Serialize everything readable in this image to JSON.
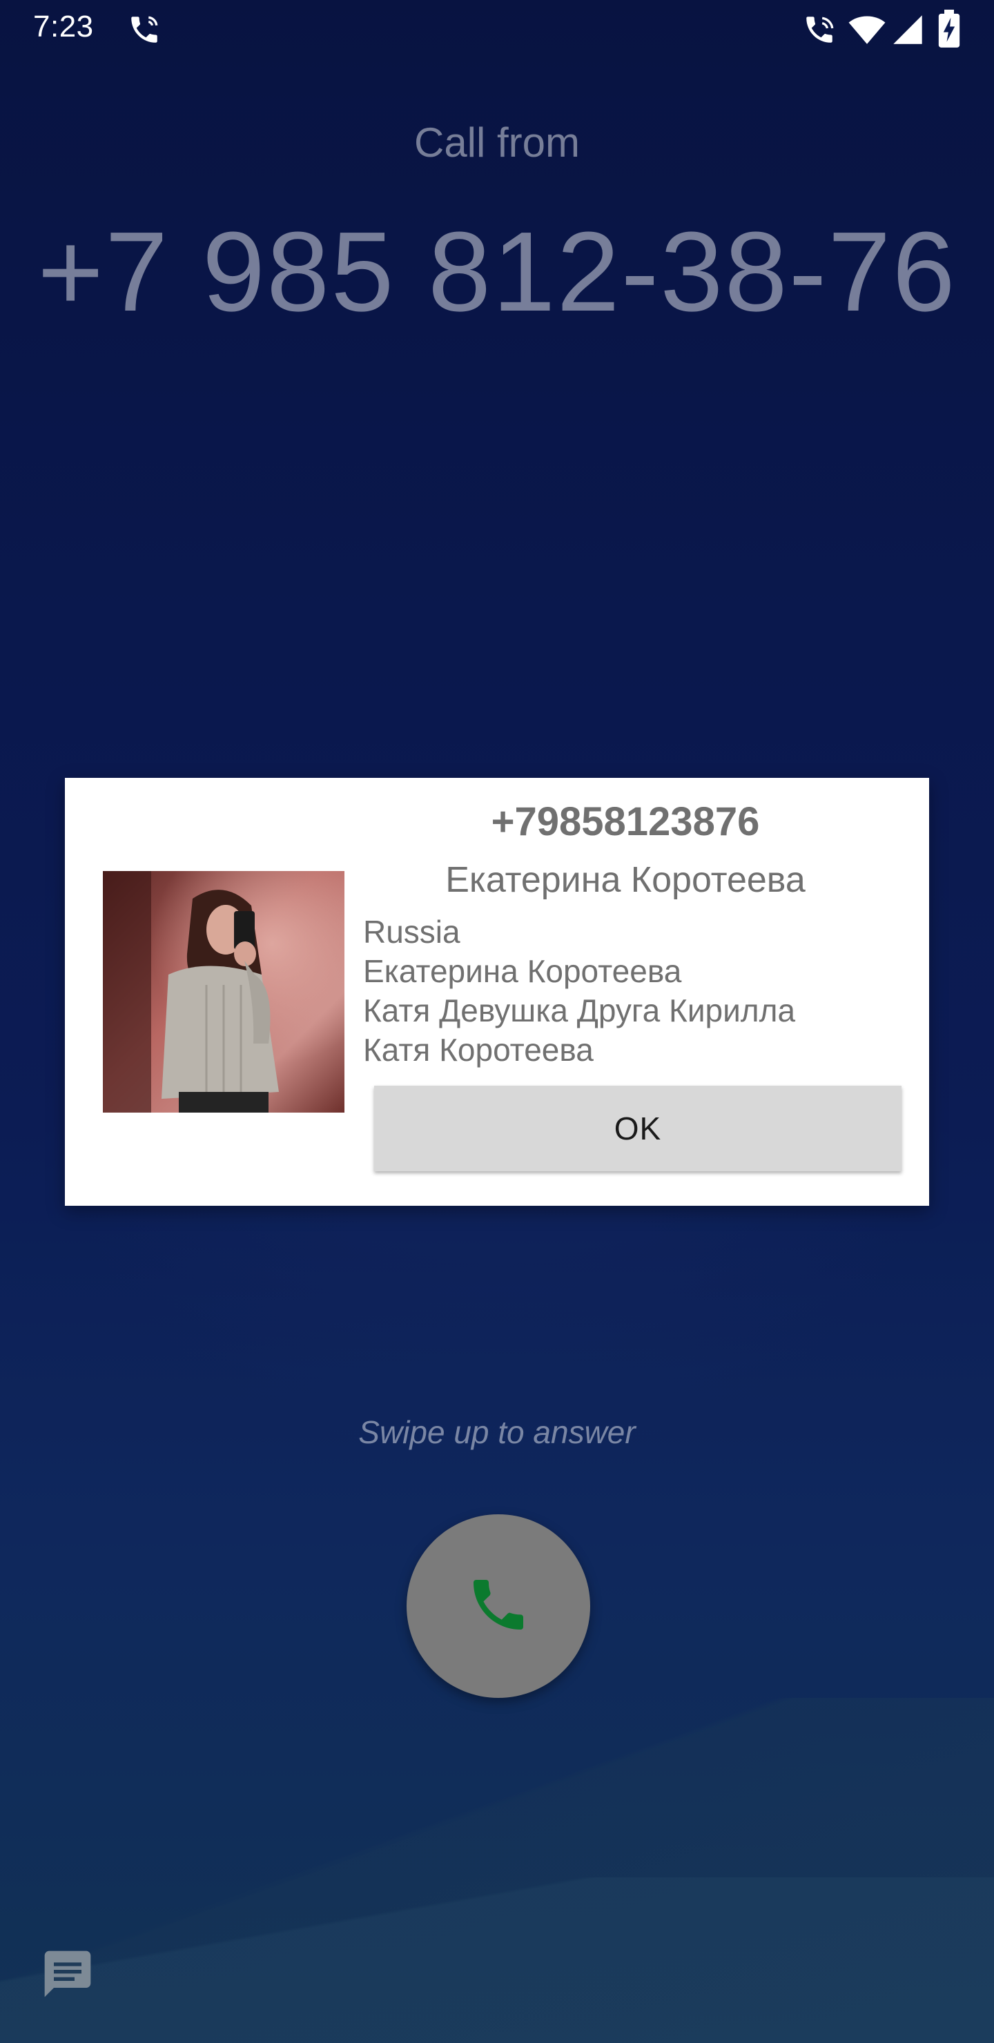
{
  "status_bar": {
    "time": "7:23",
    "icons": [
      "call-active-icon",
      "wifi-call-icon",
      "wifi-icon",
      "signal-icon",
      "battery-charging-icon"
    ]
  },
  "call": {
    "label": "Call from",
    "number": "+7 985 812-38-76"
  },
  "dialog": {
    "number": "+79858123876",
    "name": "Екатерина Коротеева",
    "lines": [
      "Russia",
      "Екатерина Коротеева",
      "Катя Девушка Друга Кирилла",
      "Катя Коротеева"
    ],
    "ok_label": "OK"
  },
  "answer": {
    "hint": "Swipe up to answer",
    "accent_color": "#0b7a2e"
  },
  "bottom": {
    "icon": "message-icon"
  }
}
